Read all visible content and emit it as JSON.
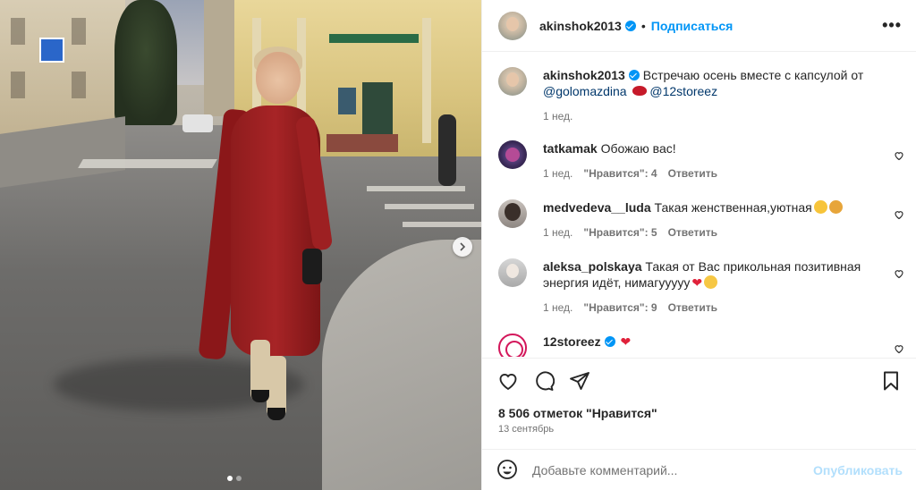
{
  "post": {
    "author": "akinshok2013",
    "separator": "•",
    "follow_label": "Подписаться",
    "more_label": "•••",
    "caption": {
      "text": "Встречаю осень вместе с капсулой от",
      "mention1": "@golomazdina",
      "mention2": "@12storeez",
      "time": "1 нед."
    },
    "comments": [
      {
        "user": "tatkamak",
        "text": "Обожаю вас!",
        "time": "1 нед.",
        "likes": "\"Нравится\": 4",
        "reply": "Ответить"
      },
      {
        "user": "medvedeva__luda",
        "text": "Такая женственная,уютная",
        "time": "1 нед.",
        "likes": "\"Нравится\": 5",
        "reply": "Ответить"
      },
      {
        "user": "aleksa_polskaya",
        "text": "Такая от Вас прикольная позитивная энергия идёт, нимагууууу",
        "time": "1 нед.",
        "likes": "\"Нравится\": 9",
        "reply": "Ответить"
      },
      {
        "user": "12storeez",
        "text": ""
      }
    ],
    "likes_count": "8 506 отметок \"Нравится\"",
    "date": "13 сентябрь",
    "comment_placeholder": "Добавьте комментарий...",
    "publish_label": "Опубликовать"
  },
  "carousel": {
    "current_slide": 1,
    "total_slides": 2
  },
  "colors": {
    "accent": "#0095f6",
    "text": "#262626",
    "muted": "#737373",
    "dress": "#a72426"
  },
  "icons": [
    "verified-icon",
    "more-icon",
    "heart-icon",
    "comment-icon",
    "share-icon",
    "bookmark-icon",
    "emoji-icon",
    "chevron-right-icon"
  ]
}
